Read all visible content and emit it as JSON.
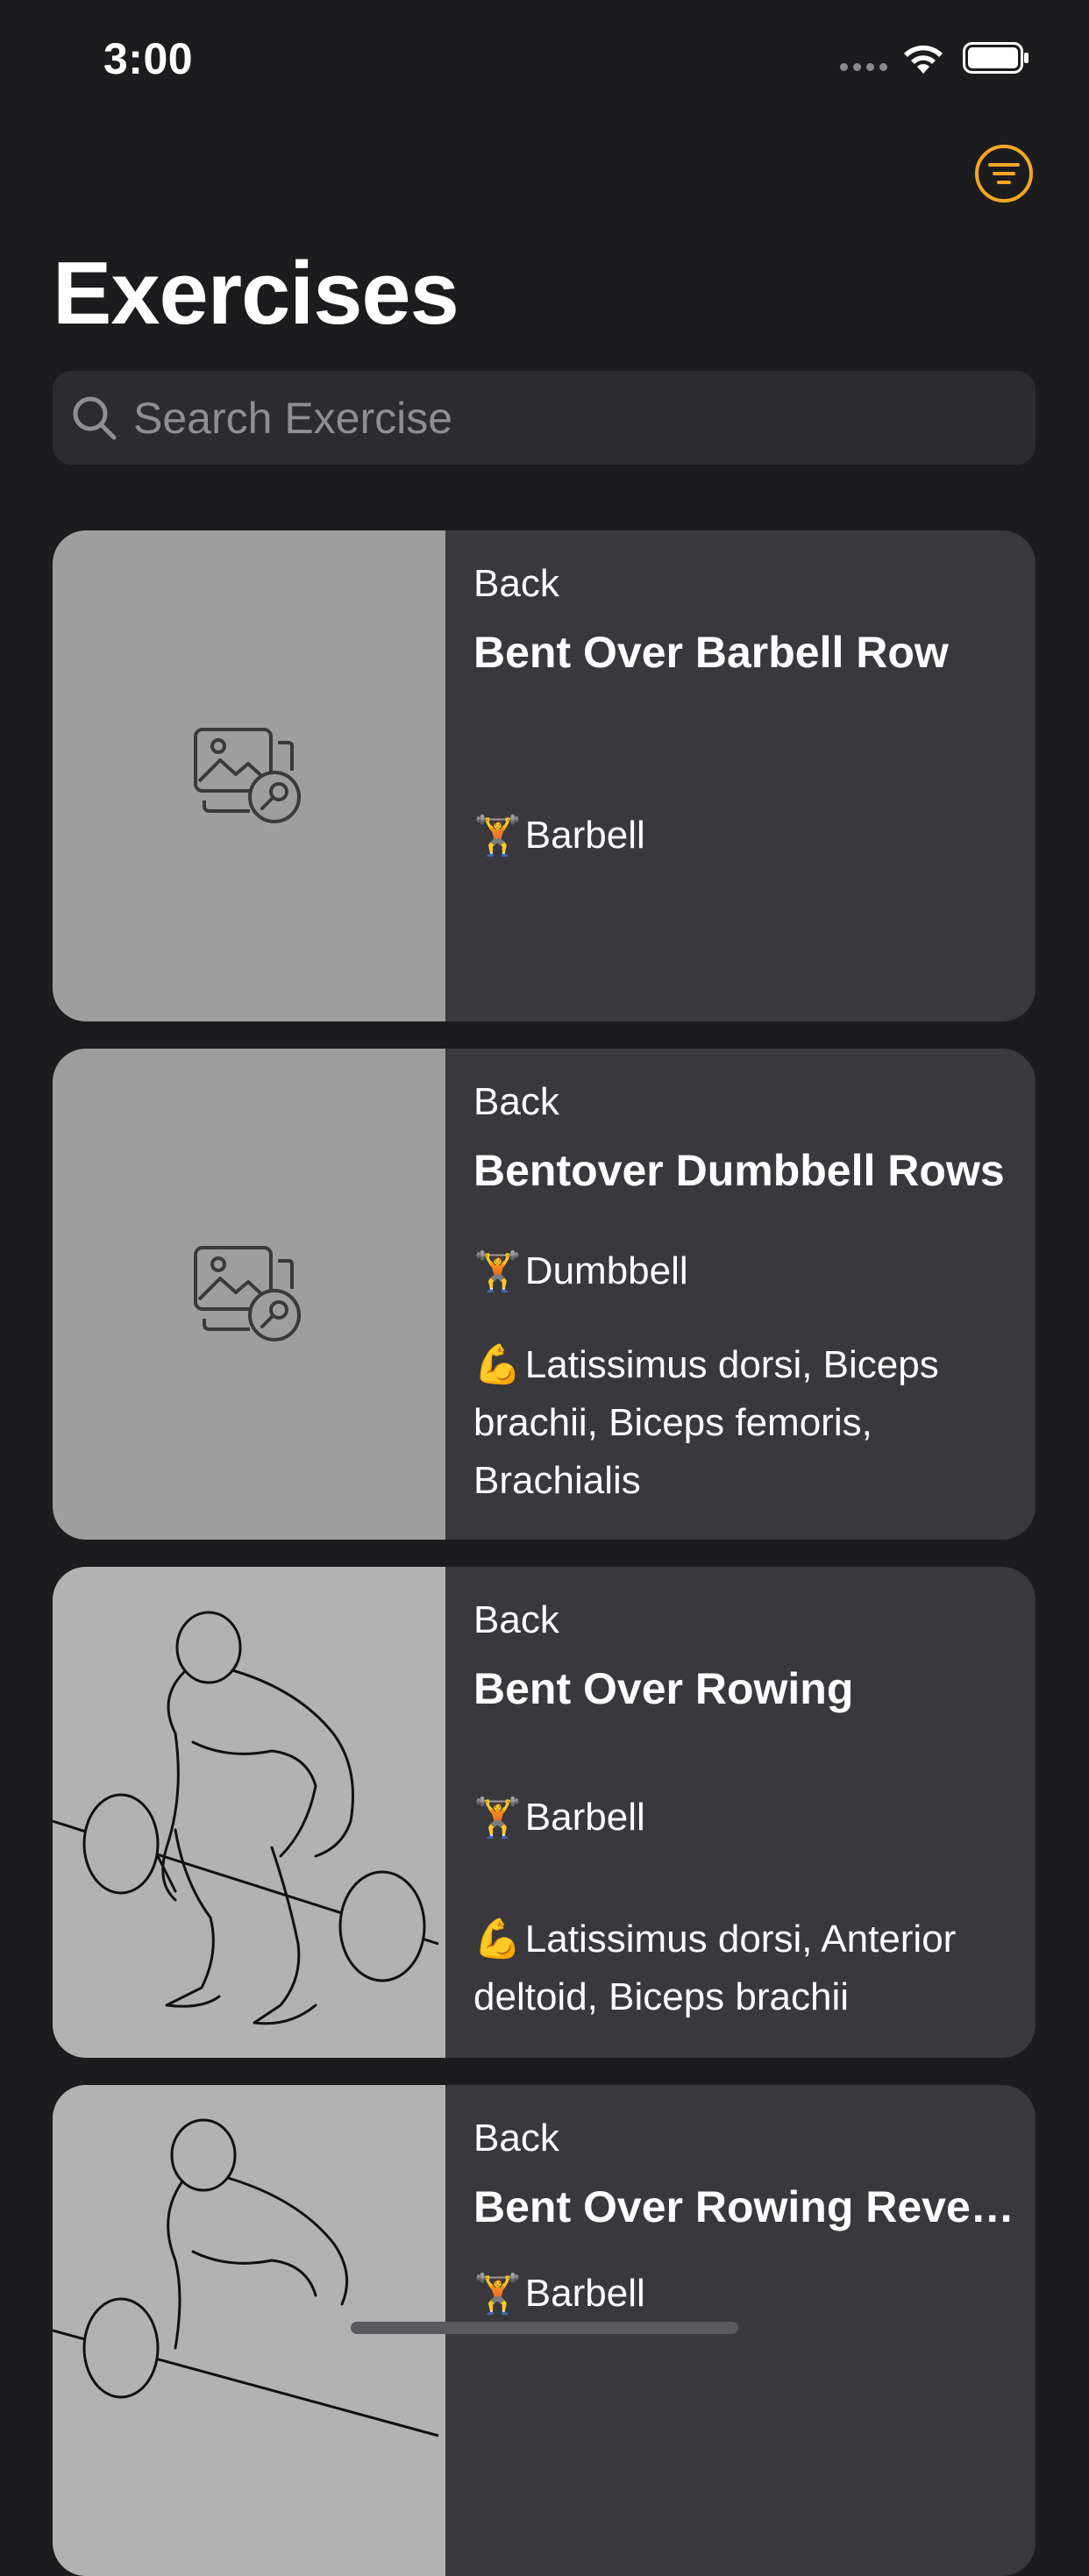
{
  "status_bar": {
    "time": "3:00"
  },
  "header": {
    "title": "Exercises"
  },
  "search": {
    "placeholder": "Search Exercise"
  },
  "exercises": [
    {
      "category": "Back",
      "name": "Bent Over Barbell Row",
      "equipment_icon": "🏋",
      "equipment": "Barbell",
      "muscles": ""
    },
    {
      "category": "Back",
      "name": "Bentover Dumbbell Rows",
      "equipment_icon": "🏋",
      "equipment": "Dumbbell",
      "muscle_icon": "💪",
      "muscles": "Latissimus dorsi, Biceps brachii, Biceps femoris, Brachialis"
    },
    {
      "category": "Back",
      "name": "Bent Over Rowing",
      "equipment_icon": "🏋",
      "equipment": "Barbell",
      "muscle_icon": "💪",
      "muscles": "Latissimus dorsi, Anterior deltoid, Biceps brachii"
    },
    {
      "category": "Back",
      "name": "Bent Over Rowing Rever...",
      "equipment_icon": "🏋",
      "equipment": "Barbell"
    }
  ],
  "colors": {
    "accent": "#f5a623",
    "background": "#1c1c1e",
    "card": "#38383d"
  }
}
